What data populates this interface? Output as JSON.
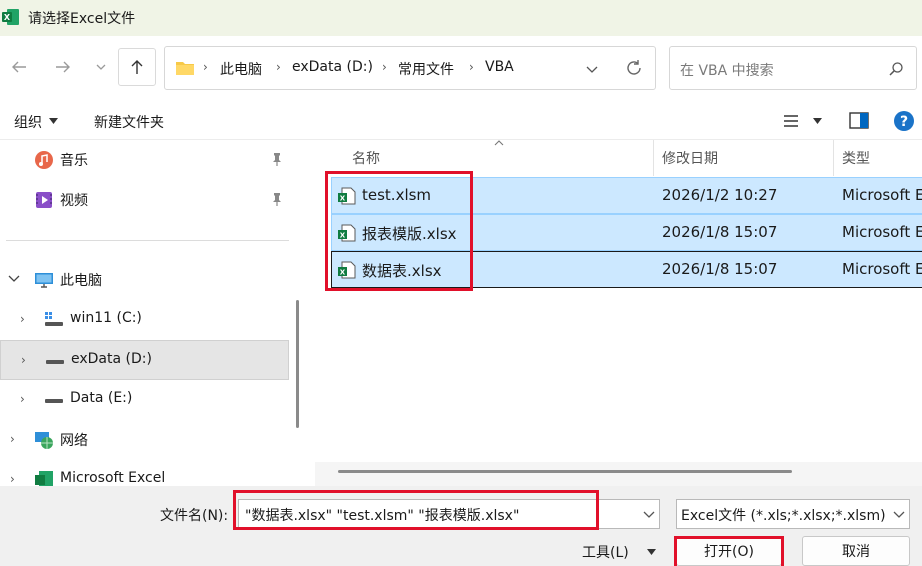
{
  "window": {
    "title": "请选择Excel文件"
  },
  "address": {
    "crumbs": [
      "此电脑",
      "exData (D:)",
      "常用文件",
      "VBA"
    ],
    "search_placeholder": "在 VBA 中搜索"
  },
  "toolbar": {
    "organize_label": "组织",
    "new_folder_label": "新建文件夹"
  },
  "tree": {
    "quick_items": [
      {
        "label": "音乐",
        "icon": "music-icon"
      },
      {
        "label": "视频",
        "icon": "video-icon"
      }
    ],
    "this_pc": "此电脑",
    "drives": [
      {
        "label": "win11 (C:)",
        "icon": "windows-drive-icon"
      },
      {
        "label": "exData (D:)",
        "icon": "drive-icon",
        "selected": true
      },
      {
        "label": "Data (E:)",
        "icon": "drive-icon"
      }
    ],
    "network": "网络",
    "excel_item": "Microsoft Excel"
  },
  "filelist": {
    "columns": {
      "name": "名称",
      "modified": "修改日期",
      "type": "类型"
    },
    "files": [
      {
        "name": "test.xlsm",
        "modified": "2026/1/2 10:27",
        "type": "Microsoft Excel"
      },
      {
        "name": "报表模版.xlsx",
        "modified": "2026/1/8 15:07",
        "type": "Microsoft Excel"
      },
      {
        "name": "数据表.xlsx",
        "modified": "2026/1/8 15:07",
        "type": "Microsoft Excel"
      }
    ]
  },
  "bottom": {
    "filename_label": "文件名(N):",
    "filename_value": "\"数据表.xlsx\" \"test.xlsm\" \"报表模版.xlsx\"",
    "filter_value": "Excel文件 (*.xls;*.xlsx;*.xlsm)",
    "tools_label": "工具(L)",
    "open_label": "打开(O)",
    "cancel_label": "取消"
  },
  "colors": {
    "accent": "#0067c0",
    "selection": "#cce8ff",
    "annotation": "#e1102a"
  }
}
